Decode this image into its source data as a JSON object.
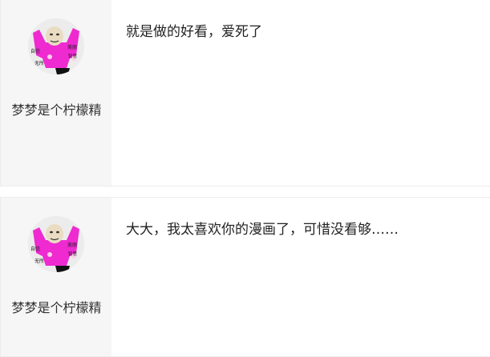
{
  "comments": [
    {
      "username": "梦梦是个柠檬精",
      "avatar_icon": "meme-face-avatar-icon",
      "avatar_text": [
        "自信",
        "美丽",
        "智慧",
        "无所"
      ],
      "text": "就是做的好看，爱死了"
    },
    {
      "username": "梦梦是个柠檬精",
      "avatar_icon": "meme-face-avatar-icon",
      "avatar_text": [
        "自信",
        "美丽",
        "智慧",
        "无所"
      ],
      "text": "大大，我太喜欢你的漫画了，可惜没看够……"
    }
  ],
  "colors": {
    "avatar_pink": "#ee2ad0",
    "user_column_bg": "#f6f6f6",
    "divider": "#ececec"
  }
}
